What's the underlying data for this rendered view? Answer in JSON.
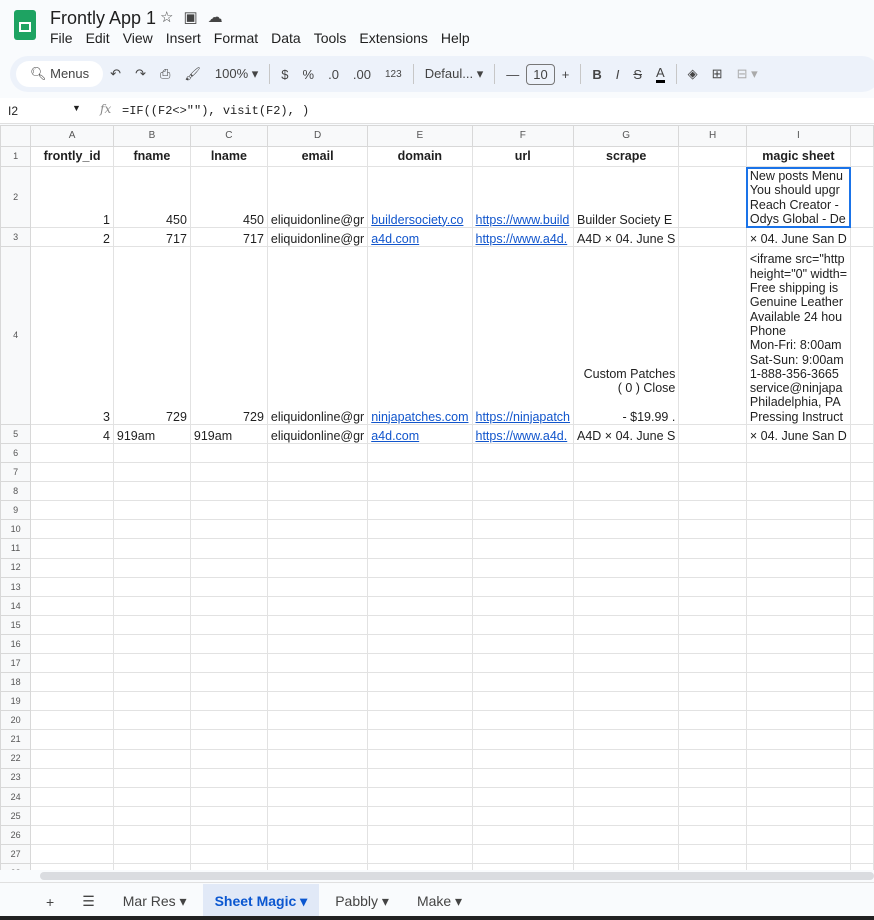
{
  "app": {
    "title": "Frontly App 1",
    "brand_color": "#1ea362"
  },
  "menu": [
    "File",
    "Edit",
    "View",
    "Insert",
    "Format",
    "Data",
    "Tools",
    "Extensions",
    "Help"
  ],
  "toolbar": {
    "search": "Menus",
    "zoom": "100%",
    "currency": "$",
    "percent": "%",
    "dec_dec": ".0",
    "inc_dec": ".00",
    "format123": "123",
    "font": "Defaul...",
    "font_size": "10",
    "bold": "B",
    "italic": "I",
    "strike": "S",
    "text_color": "A"
  },
  "formula_bar": {
    "cell_ref": "I2",
    "formula": "=IF((F2<>\"\"), visit(F2), )"
  },
  "columns": [
    "A",
    "B",
    "C",
    "D",
    "E",
    "F",
    "G",
    "H",
    "I",
    ""
  ],
  "rows": [
    [
      "frontly_id",
      "fname",
      "lname",
      "email",
      "domain",
      "url",
      "scrape",
      "",
      "magic sheet",
      ""
    ],
    [
      "1",
      "450",
      "450",
      "eliquidonline@gr",
      "buildersociety.co",
      "https://www.build",
      "Builder Society E",
      "",
      "New posts Menu\nYou should upgr\nReach Creator -\nOdys Global - De",
      ""
    ],
    [
      "2",
      "717",
      "717",
      "eliquidonline@gr",
      "a4d.com",
      "https://www.a4d.",
      "A4D × 04. June S",
      "",
      "× 04. June San D",
      ""
    ],
    [
      "3",
      "729",
      "729",
      "eliquidonline@gr",
      "ninjapatches.com",
      "https://ninjapatch",
      "Custom Patches\n( 0 ) Close\n\n- $19.99 .",
      "",
      "<iframe src=\"http\nheight=\"0\" width=\nFree shipping is\nGenuine Leather\nAvailable 24 hou\nPhone\nMon-Fri: 8:00am\nSat-Sun: 9:00am\n1-888-356-3665\nservice@ninjapa\nPhiladelphia, PA\nPressing Instruct",
      ""
    ],
    [
      "4",
      "919am",
      "919am",
      "eliquidonline@gr",
      "a4d.com",
      "https://www.a4d.",
      "A4D × 04. June S",
      "",
      "× 04. June San D",
      ""
    ]
  ],
  "row_numbers": [
    "1",
    "2",
    "3",
    "4",
    "5",
    "6",
    "7",
    "8",
    "9",
    "10",
    "11",
    "12",
    "13",
    "14",
    "15",
    "16",
    "17",
    "18",
    "19",
    "20",
    "21",
    "22",
    "23",
    "24",
    "25",
    "26",
    "27",
    "28"
  ],
  "sheet_tabs": [
    {
      "label": "Mar Res",
      "active": false
    },
    {
      "label": "Sheet Magic",
      "active": true
    },
    {
      "label": "Pabbly",
      "active": false
    },
    {
      "label": "Make",
      "active": false
    }
  ]
}
